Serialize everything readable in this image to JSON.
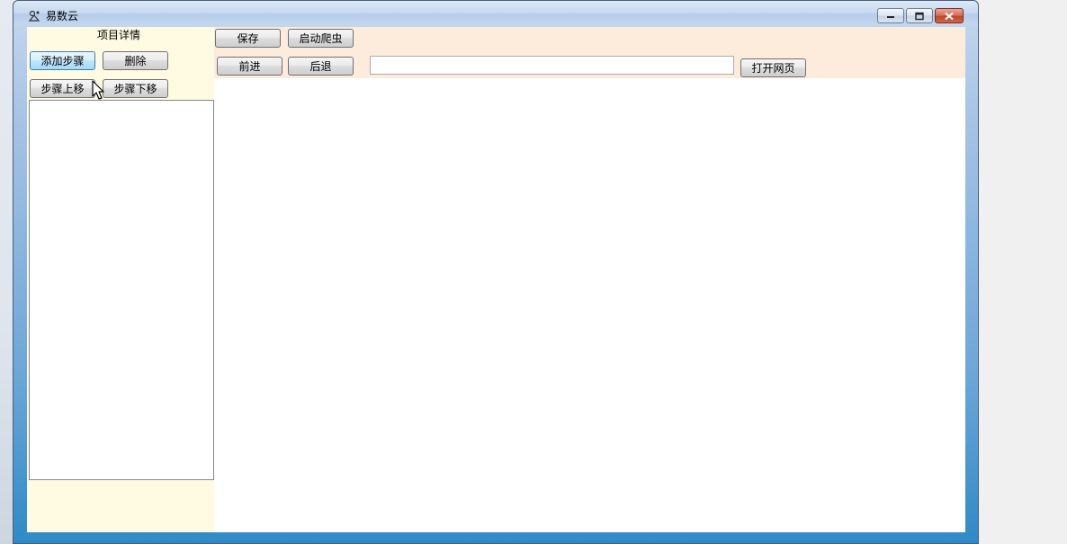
{
  "window": {
    "title": "易数云"
  },
  "left_panel": {
    "title": "项目详情",
    "add_step_label": "添加步骤",
    "delete_label": "删除",
    "step_up_label": "步骤上移",
    "step_down_label": "步骤下移",
    "steps": []
  },
  "toolbar": {
    "save_label": "保存",
    "start_crawler_label": "启动爬虫",
    "forward_label": "前进",
    "back_label": "后退",
    "url_value": "",
    "open_page_label": "打开网页"
  },
  "icons": {
    "app": "app-logo-icon",
    "minimize": "minimize-icon",
    "maximize": "maximize-icon",
    "close": "close-icon",
    "cursor": "mouse-cursor-icon"
  },
  "colors": {
    "left_panel_bg": "#fffbe2",
    "toolbar_bg": "#fdebdc",
    "hover_button": "#bee6fd",
    "close_button": "#c0452c"
  }
}
